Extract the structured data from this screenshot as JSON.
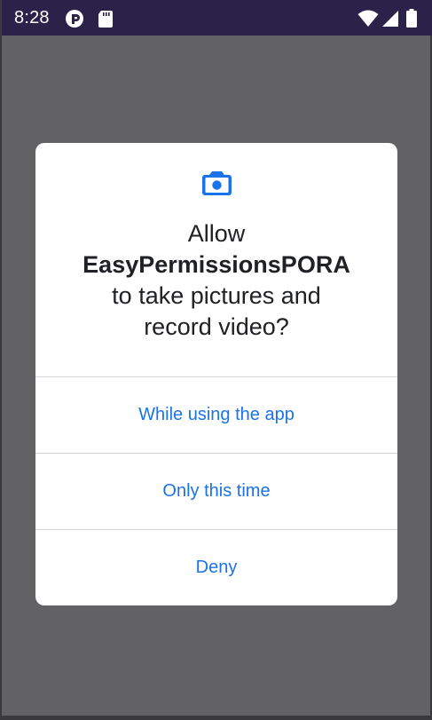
{
  "status_bar": {
    "time": "8:28",
    "icons": [
      "p-circle-icon",
      "sd-card-icon",
      "wifi-icon",
      "cell-signal-icon",
      "battery-icon"
    ]
  },
  "dialog": {
    "icon": "camera-icon",
    "title_line1": "Allow",
    "app_name": "EasyPermissionsPORA",
    "title_line3": "to take pictures and",
    "title_line4": "record video?",
    "options": [
      {
        "label": "While using the app"
      },
      {
        "label": "Only this time"
      },
      {
        "label": "Deny"
      }
    ]
  },
  "colors": {
    "status_bar_bg": "#2a2249",
    "scrim": "#626265",
    "accent": "#1a73e8",
    "dialog_bg": "#ffffff",
    "title_text": "#202124"
  }
}
